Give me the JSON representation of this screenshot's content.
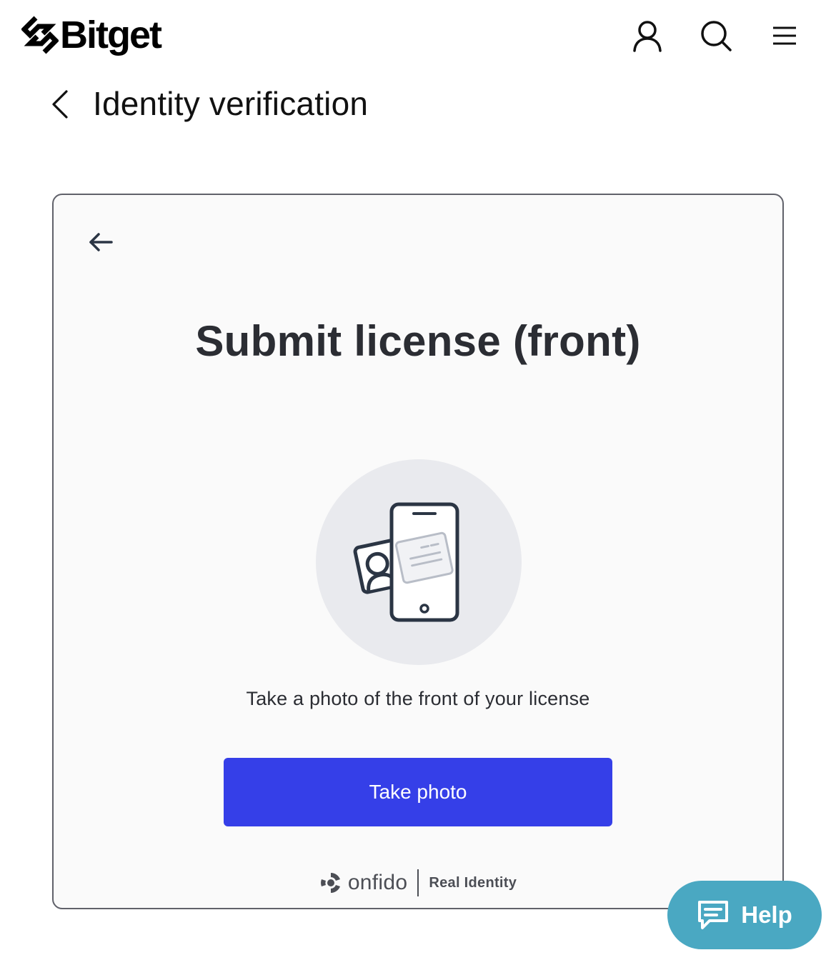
{
  "header": {
    "brand_name": "Bitget",
    "icons": [
      "user-icon",
      "search-icon",
      "menu-icon"
    ]
  },
  "subheader": {
    "title": "Identity verification"
  },
  "card": {
    "title": "Submit license (front)",
    "instruction": "Take a photo of the front of your license",
    "primary_button": "Take photo",
    "footer": {
      "brand_word": "onfido",
      "tagline": "Real Identity"
    }
  },
  "help_button": {
    "label": "Help"
  },
  "colors": {
    "primary_button": "#353fe8",
    "help_button": "#4aa8c2",
    "card_border": "#60616a",
    "illustration_circle": "#e9eaee",
    "illustration_stroke": "#2b3544"
  }
}
